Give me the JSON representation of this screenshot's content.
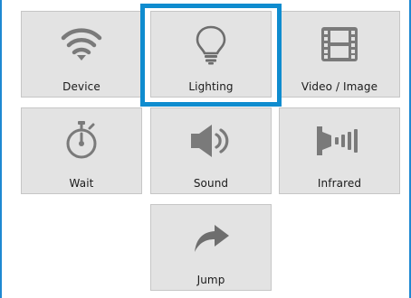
{
  "tiles": [
    {
      "label": "Device",
      "icon": "wifi-icon"
    },
    {
      "label": "Lighting",
      "icon": "lightbulb-icon"
    },
    {
      "label": "Video / Image",
      "icon": "film-icon"
    },
    {
      "label": "Wait",
      "icon": "stopwatch-icon"
    },
    {
      "label": "Sound",
      "icon": "speaker-icon"
    },
    {
      "label": "Infrared",
      "icon": "infrared-icon"
    },
    {
      "label": "Jump",
      "icon": "jump-arrow-icon"
    }
  ],
  "selected_tile": "Lighting",
  "colors": {
    "selection": "#0f8ccf",
    "panel_border": "#1e88d2",
    "tile_bg": "#e3e3e3",
    "icon": "#7a7a7a"
  }
}
